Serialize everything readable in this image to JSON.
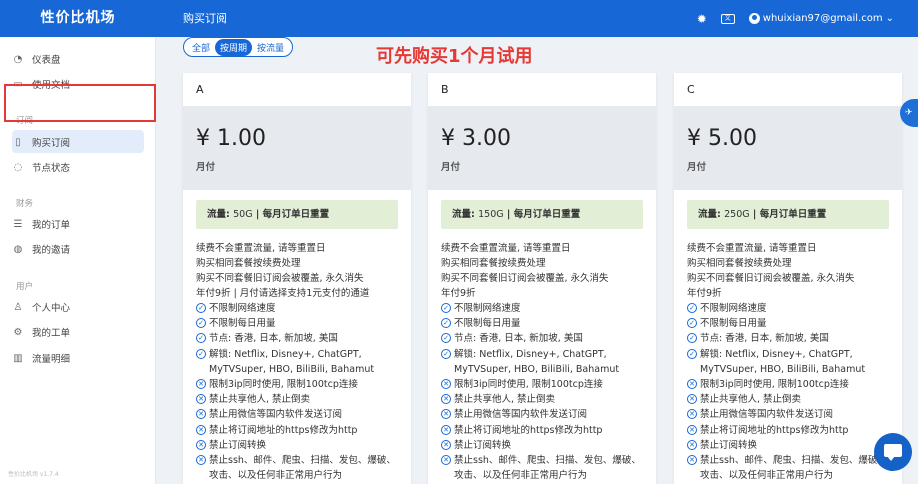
{
  "topbar": {
    "brand": "性价比机场",
    "page_title": "购买订阅",
    "user_email": "whuixian97@gmail.com"
  },
  "sidebar": {
    "items": [
      {
        "label": "仪表盘",
        "icon": "dashboard-icon"
      },
      {
        "label": "使用文档",
        "icon": "document-icon"
      },
      {
        "label": "购买订阅",
        "icon": "clipboard-icon"
      },
      {
        "label": "节点状态",
        "icon": "node-status-icon"
      },
      {
        "label": "我的订单",
        "icon": "list-icon"
      },
      {
        "label": "我的邀请",
        "icon": "invite-icon"
      },
      {
        "label": "个人中心",
        "icon": "user-icon"
      },
      {
        "label": "我的工单",
        "icon": "ticket-icon"
      },
      {
        "label": "流量明细",
        "icon": "bar-chart-icon"
      }
    ],
    "groups": [
      "订阅",
      "财务",
      "用户"
    ],
    "version": "性价比机场 v1.7.4"
  },
  "filters": [
    "全部",
    "按周期",
    "按流量"
  ],
  "promo_text": "可先购买1个月试用",
  "plans": [
    {
      "name": "A",
      "price": "¥ 1.00",
      "period": "月付",
      "traffic_label": "流量: ",
      "traffic_value": "50G",
      "traffic_reset": " | 每月订单日重置",
      "desc": [
        "续费不会重置流量, 请等重置日",
        "购买相同套餐按续费处理",
        "购买不同套餐旧订阅会被覆盖, 永久消失",
        "年付9折 | 月付请选择支持1元支付的通道"
      ]
    },
    {
      "name": "B",
      "price": "¥ 3.00",
      "period": "月付",
      "traffic_label": "流量: ",
      "traffic_value": "150G",
      "traffic_reset": " | 每月订单日重置",
      "desc": [
        "续费不会重置流量, 请等重置日",
        "购买相同套餐按续费处理",
        "购买不同套餐旧订阅会被覆盖, 永久消失",
        "年付9折"
      ]
    },
    {
      "name": "C",
      "price": "¥ 5.00",
      "period": "月付",
      "traffic_label": "流量: ",
      "traffic_value": "250G",
      "traffic_reset": " | 每月订单日重置",
      "desc": [
        "续费不会重置流量, 请等重置日",
        "购买相同套餐按续费处理",
        "购买不同套餐旧订阅会被覆盖, 永久消失",
        "年付9折"
      ]
    }
  ],
  "features_check": [
    "不限制网络速度",
    "不限制每日用量",
    "节点: 香港, 日本, 新加坡, 美国",
    "解锁: Netflix, Disney+, ChatGPT, MyTVSuper, HBO, BiliBili, Bahamut"
  ],
  "features_cross": [
    "限制3ip同时使用, 限制100tcp连接",
    "禁止共享他人, 禁止倒卖",
    "禁止用微信等国内软件发送订阅",
    "禁止将订阅地址的https修改为http",
    "禁止订阅转换",
    "禁止ssh、邮件、爬虫、扫描、发包、爆破、攻击、以及任何非正常用户行为"
  ],
  "colors": {
    "brand_blue": "#1768d6",
    "promo_red": "#e53935",
    "traffic_bg": "#e2efd6"
  }
}
